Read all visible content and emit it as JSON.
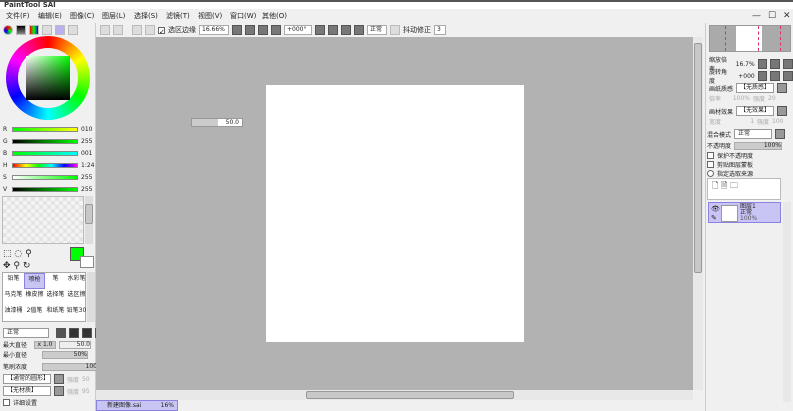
{
  "app": {
    "title": "PaintTool SAI"
  },
  "menu": [
    "文件(F)",
    "编辑(E)",
    "图像(C)",
    "图层(L)",
    "选择(S)",
    "滤镜(T)",
    "视图(V)",
    "窗口(W)",
    "其他(O)"
  ],
  "window_controls": [
    "minimize",
    "maximize",
    "close"
  ],
  "toolbar": {
    "selection_edge_label": "选区边缘",
    "selection_edge_checked": true,
    "zoom": "16.66%",
    "rotation": "+000°",
    "blend": "正常",
    "stabilizer_label": "抖动修正",
    "stabilizer": "3"
  },
  "color": {
    "current": "#00ff00",
    "sliders": [
      {
        "label": "R",
        "value": "010"
      },
      {
        "label": "G",
        "value": "255"
      },
      {
        "label": "B",
        "value": "001"
      },
      {
        "label": "H",
        "value": "1:24"
      },
      {
        "label": "S",
        "value": "255"
      },
      {
        "label": "V",
        "value": "255"
      }
    ]
  },
  "brushes": [
    "铅笔",
    "喷枪",
    "笔",
    "水彩笔",
    "马克笔",
    "橡皮擦",
    "选择笔",
    "选区擦",
    "油漆桶",
    "2值笔",
    "和纸笔",
    "铅笔30"
  ],
  "brush_settings": {
    "mode": "正常",
    "max_size_label": "最大直径",
    "max_size_mult": "x 1.0",
    "max_size": "50.0",
    "min_size_label": "最小直径",
    "min_size": "50%",
    "density_label": "笔刷浓度",
    "density": "100",
    "shape": "【通常的圆形】",
    "shape_strength_label": "强度",
    "shape_strength": "50",
    "texture": "【无材质】",
    "texture_strength_label": "强度",
    "texture_strength": "95",
    "detail_label": "详细设置"
  },
  "canvas": {
    "size_popup_value": "50.0"
  },
  "navigator": {
    "zoom_label": "缩放倍率",
    "zoom": "16.7%",
    "angle_label": "旋转角度",
    "angle": "+000"
  },
  "layer_props": {
    "paper_label": "画纸质感",
    "paper": "【无质感】",
    "paper_scale_label": "倍率",
    "paper_scale": "100%",
    "paper_strength_label": "强度",
    "paper_strength": "20",
    "effect_label": "画材效果",
    "effect": "【无效果】",
    "effect_width_label": "宽度",
    "effect_width": "1",
    "effect_strength_label": "强度",
    "effect_strength": "100",
    "blend_label": "混合模式",
    "blend": "正常",
    "opacity_label": "不透明度",
    "opacity": "100%",
    "checks": [
      "保护不透明度",
      "剪贴图层蒙板",
      "指定选取来源"
    ]
  },
  "layers": [
    {
      "name": "图层1",
      "mode": "正常",
      "opacity": "100%"
    }
  ],
  "status": {
    "doc_name": "新建图像.sai",
    "doc_zoom": "16%"
  }
}
